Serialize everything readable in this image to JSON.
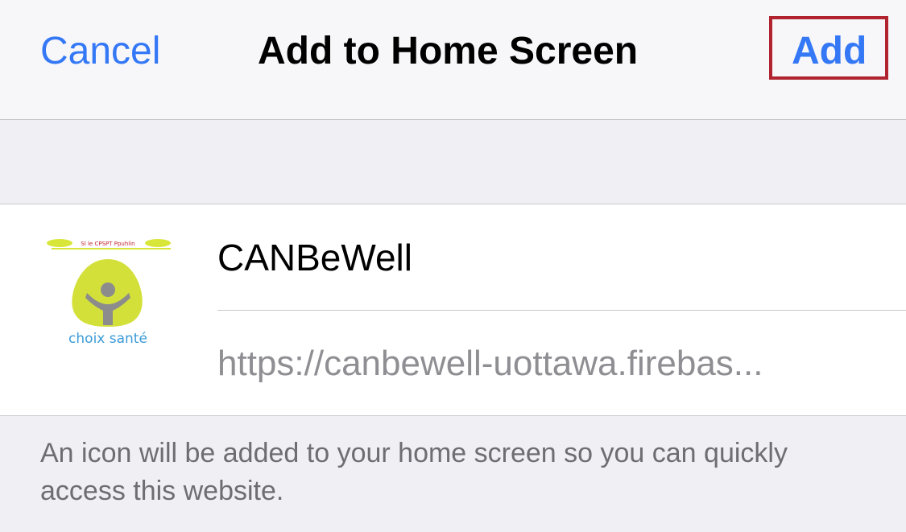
{
  "navbar": {
    "cancel_label": "Cancel",
    "title": "Add to Home Screen",
    "add_label": "Add",
    "highlight_color": "#b0232f"
  },
  "bookmark": {
    "icon": {
      "name": "choix-sante-app-icon",
      "caption": "choix santé",
      "banner_text": "Sl     le      CPSPT  Ppuhlin"
    },
    "name_value": "CANBeWell",
    "url": "https://canbewell-uottawa.firebas..."
  },
  "footer": {
    "note": "An icon will be added to your home screen so you can quickly access this website."
  },
  "colors": {
    "accent": "#3478f6",
    "title": "#000000",
    "secondary_text": "#8e8e93",
    "background": "#efeff4"
  }
}
